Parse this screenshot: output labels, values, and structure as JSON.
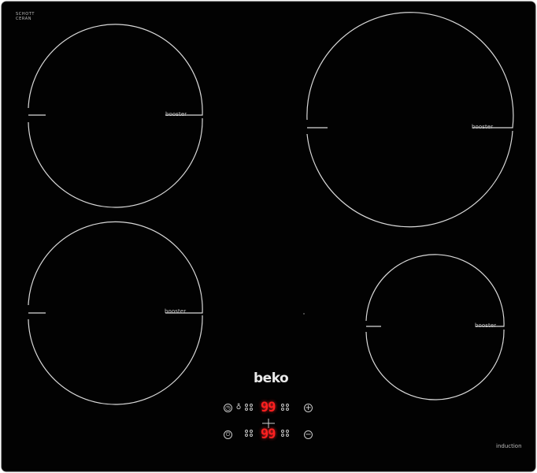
{
  "appliance": {
    "brand": "beko",
    "type_label": "induction",
    "glass_label_lines": [
      "SCHOTT",
      "CERAN"
    ],
    "surface_color": "#020202",
    "line_color": "#d9d9d9",
    "display_color": "#ff2020"
  },
  "zones": [
    {
      "name": "front-left",
      "booster_label": "booster"
    },
    {
      "name": "back-left",
      "booster_label": "booster"
    },
    {
      "name": "back-right",
      "booster_label": "booster"
    },
    {
      "name": "front-right",
      "booster_label": "booster"
    }
  ],
  "control_panel": {
    "display_top": "99",
    "display_bottom": "99",
    "icons": [
      "timer-icon",
      "lock-icon",
      "plus-icon",
      "power-icon",
      "minus-icon"
    ]
  }
}
